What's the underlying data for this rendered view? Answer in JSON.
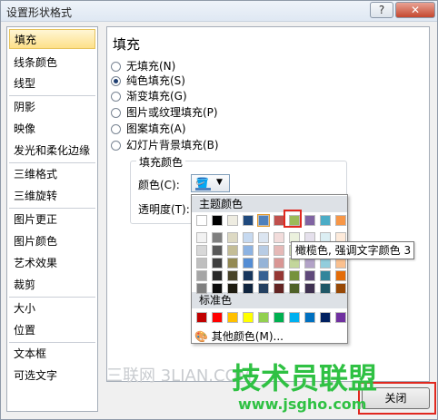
{
  "window": {
    "title": "设置形状格式",
    "help_label": "?",
    "close_label": "✕"
  },
  "sidebar": {
    "items": [
      {
        "label": "填充",
        "selected": true
      },
      {
        "label": "线条颜色"
      },
      {
        "label": "线型"
      },
      {
        "label": "阴影"
      },
      {
        "label": "映像"
      },
      {
        "label": "发光和柔化边缘"
      },
      {
        "label": "三维格式"
      },
      {
        "label": "三维旋转"
      },
      {
        "label": "图片更正"
      },
      {
        "label": "图片颜色"
      },
      {
        "label": "艺术效果"
      },
      {
        "label": "裁剪"
      },
      {
        "label": "大小"
      },
      {
        "label": "位置"
      },
      {
        "label": "文本框"
      },
      {
        "label": "可选文字"
      }
    ]
  },
  "fill": {
    "heading": "填充",
    "options": [
      {
        "label": "无填充(N)",
        "checked": false
      },
      {
        "label": "纯色填充(S)",
        "checked": true
      },
      {
        "label": "渐变填充(G)",
        "checked": false
      },
      {
        "label": "图片或纹理填充(P)",
        "checked": false
      },
      {
        "label": "图案填充(A)",
        "checked": false
      },
      {
        "label": "幻灯片背景填充(B)",
        "checked": false
      }
    ],
    "group_title": "填充颜色",
    "color_label": "颜色(C):",
    "transparency_label": "透明度(T):",
    "selected_color": "#4f81bd"
  },
  "palette": {
    "theme_heading": "主题颜色",
    "theme_top": [
      "#ffffff",
      "#000000",
      "#eeece1",
      "#1f497d",
      "#4f81bd",
      "#c0504d",
      "#9bbb59",
      "#8064a2",
      "#4bacc6",
      "#f79646"
    ],
    "theme_shades": [
      [
        "#f2f2f2",
        "#7f7f7f",
        "#ddd9c3",
        "#c6d9f0",
        "#dbe5f1",
        "#f2dcdb",
        "#ebf1dd",
        "#e5e0ec",
        "#dbeef3",
        "#fdeada"
      ],
      [
        "#d8d8d8",
        "#595959",
        "#c4bd97",
        "#8db3e2",
        "#b8cce4",
        "#e5b9b7",
        "#d7e3bc",
        "#ccc1d9",
        "#b7dde8",
        "#fbd5b5"
      ],
      [
        "#bfbfbf",
        "#3f3f3f",
        "#938953",
        "#548dd4",
        "#95b3d7",
        "#d99694",
        "#c3d69b",
        "#b2a2c7",
        "#92cddc",
        "#fac08f"
      ],
      [
        "#a5a5a5",
        "#262626",
        "#494429",
        "#17365d",
        "#366092",
        "#953734",
        "#76923c",
        "#5f497a",
        "#31859b",
        "#e36c09"
      ],
      [
        "#7f7f7f",
        "#0c0c0c",
        "#1d1b10",
        "#0f243e",
        "#244061",
        "#632423",
        "#4f6128",
        "#3f3151",
        "#205867",
        "#974806"
      ]
    ],
    "standard_heading": "标准色",
    "standard": [
      "#c00000",
      "#ff0000",
      "#ffc000",
      "#ffff00",
      "#92d050",
      "#00b050",
      "#00b0f0",
      "#0070c0",
      "#002060",
      "#7030a0"
    ],
    "more_colors": "其他颜色(M)..."
  },
  "tooltip": "橄榄色, 强调文字颜色 3",
  "watermark": {
    "left": "三联网 3LIAN.COM",
    "logo": "技术员联盟",
    "url": "www.jsgho.com"
  },
  "footer": {
    "close_label": "关闭"
  }
}
